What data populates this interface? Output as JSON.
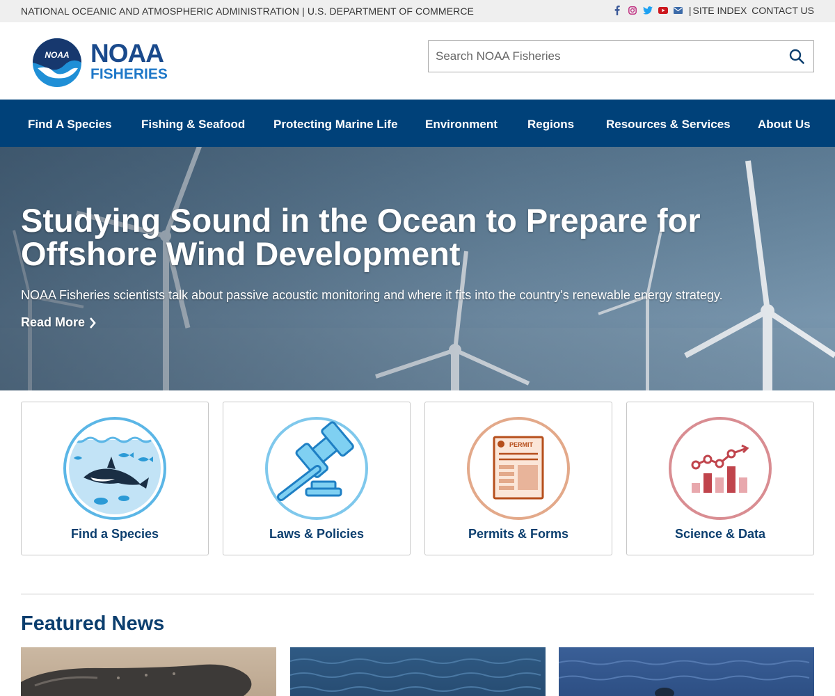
{
  "util": {
    "agency_text": "NATIONAL OCEANIC AND ATMOSPHERIC ADMINISTRATION | U.S. DEPARTMENT OF COMMERCE",
    "separator": "|",
    "site_index": "SITE INDEX",
    "contact_us": "CONTACT US",
    "social_icons": [
      "facebook-icon",
      "instagram-icon",
      "twitter-icon",
      "youtube-icon",
      "email-icon"
    ]
  },
  "logo": {
    "word1": "NOAA",
    "word2": "FISHERIES",
    "badge": "NOAA"
  },
  "search": {
    "placeholder": "Search NOAA Fisheries",
    "value": ""
  },
  "nav": {
    "items": [
      {
        "label": "Find A Species"
      },
      {
        "label": "Fishing & Seafood"
      },
      {
        "label": "Protecting Marine Life"
      },
      {
        "label": "Environment"
      },
      {
        "label": "Regions"
      },
      {
        "label": "Resources & Services"
      },
      {
        "label": "About Us"
      }
    ]
  },
  "hero": {
    "title": "Studying Sound in the Ocean to Prepare for Offshore Wind Development",
    "description": "NOAA Fisheries scientists talk about passive acoustic monitoring and where it fits into the country's renewable energy strategy.",
    "read_more": "Read More"
  },
  "cards": [
    {
      "label": "Find a Species",
      "icon": "species-icon"
    },
    {
      "label": "Laws & Policies",
      "icon": "gavel-icon"
    },
    {
      "label": "Permits & Forms",
      "icon": "permit-icon",
      "badge": "PERMIT"
    },
    {
      "label": "Science & Data",
      "icon": "chart-icon"
    }
  ],
  "featured": {
    "title": "Featured News"
  },
  "colors": {
    "nav": "#004179",
    "heading": "#0b3e6e",
    "species": "#2b9ad6",
    "laws": "#2b9ad6",
    "permits": "#c9672c",
    "science": "#c0444c"
  }
}
